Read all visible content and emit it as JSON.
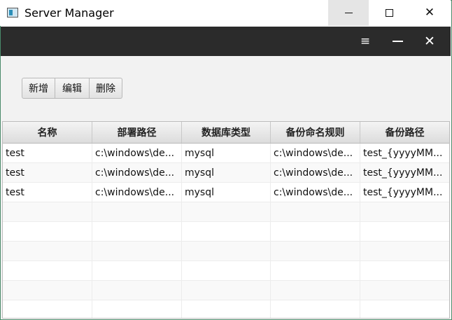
{
  "window": {
    "title": "Server Manager",
    "controls": {
      "minimize": "minimize-icon",
      "maximize": "maximize-icon",
      "close": "close-icon"
    }
  },
  "app_toolbar": {
    "menu_glyph": "≡",
    "close_glyph": "✕",
    "icons": [
      "menu-icon",
      "minimize-icon",
      "close-icon"
    ]
  },
  "actions": {
    "add_label": "新增",
    "edit_label": "编辑",
    "delete_label": "删除"
  },
  "table": {
    "columns": [
      "名称",
      "部署路径",
      "数据库类型",
      "备份命名规则",
      "备份路径"
    ],
    "rows": [
      [
        "test",
        "c:\\windows\\de...",
        "mysql",
        "c:\\windows\\de...",
        "test_{yyyyMM..."
      ],
      [
        "test",
        "c:\\windows\\de...",
        "mysql",
        "c:\\windows\\de...",
        "test_{yyyyMM..."
      ],
      [
        "test",
        "c:\\windows\\de...",
        "mysql",
        "c:\\windows\\de...",
        "test_{yyyyMM..."
      ]
    ],
    "empty_rows": 6
  },
  "colors": {
    "toolbar_bg": "#2b2b2b",
    "content_bg": "#f2f2f2",
    "frame_border": "#4a8a6a"
  }
}
